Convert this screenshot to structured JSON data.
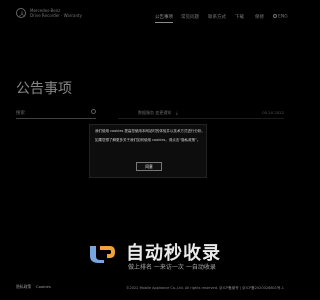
{
  "brand": {
    "line1": "Mercedes-Benz",
    "line2": "Drive Recorder · Warranty"
  },
  "nav": {
    "items": [
      {
        "label": "公告事项",
        "active": true
      },
      {
        "label": "常见问题",
        "active": false
      },
      {
        "label": "联系方式",
        "active": false
      },
      {
        "label": "下载",
        "active": false
      },
      {
        "label": "保修",
        "active": false
      },
      {
        "label": "ENG",
        "active": false
      }
    ]
  },
  "page": {
    "title": "公告事项"
  },
  "search": {
    "placeholder": "搜索"
  },
  "list": {
    "rows": [
      {
        "title": "数据服务 变更通知",
        "date": "05.20.2022"
      }
    ]
  },
  "dialog": {
    "text1": "我们使用 cookies 提高您使用本网站时的体验并以技术方式进行分析。",
    "text2": "如果您想了解更多关于我们如何使用 cookies，请点击“隐私政策”。",
    "ok_label": "同意"
  },
  "watermark": {
    "title": "自动秒收录",
    "subtitle": "做上排名 一来访一次 一自动收录"
  },
  "footer": {
    "links": [
      "隐私政策",
      "Cookies"
    ],
    "copyright": "©2022 Mobile Appliance Co.,Ltd. All rights reserved.   京ICP备案号 | 京ICP备2020026801号-1"
  }
}
